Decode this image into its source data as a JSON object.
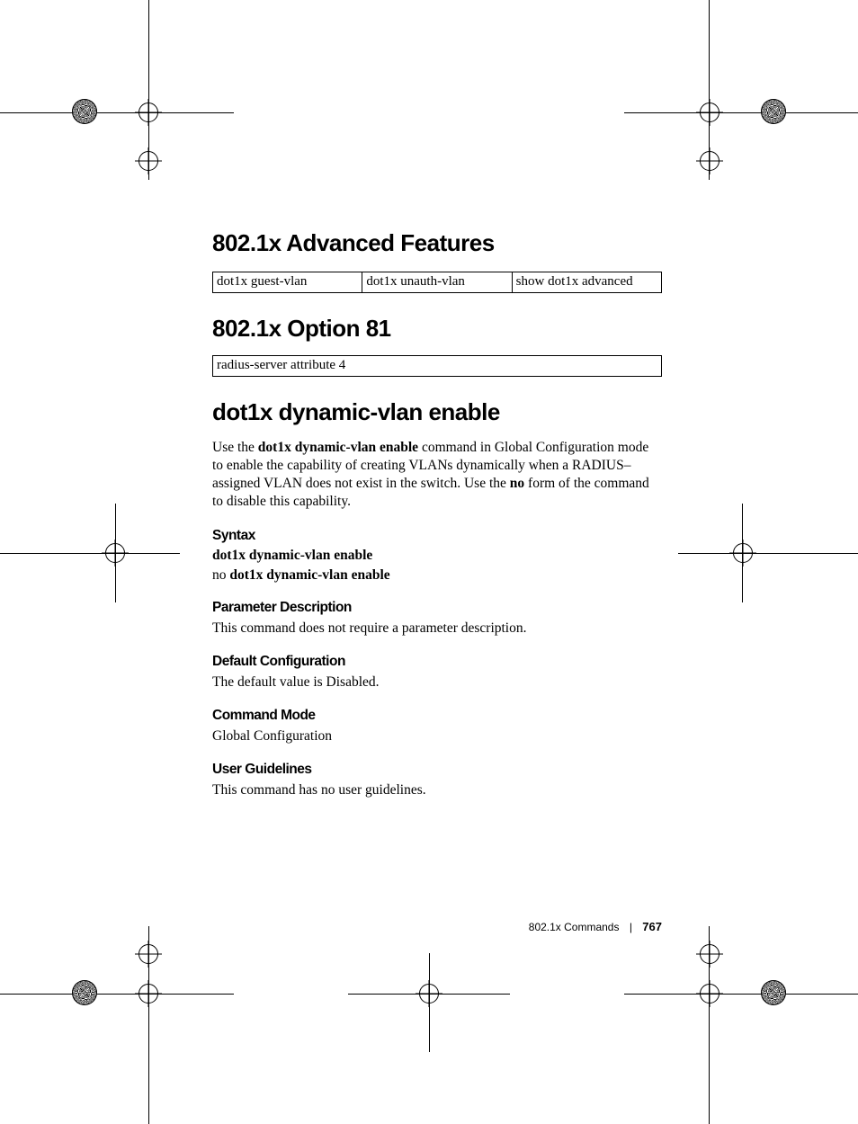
{
  "headings": {
    "advanced": "802.1x Advanced Features",
    "option81": "802.1x Option 81",
    "dynvlan": "dot1x dynamic-vlan enable"
  },
  "tables": {
    "advanced": [
      "dot1x guest-vlan",
      "dot1x unauth-vlan",
      "show dot1x advanced"
    ],
    "option81": [
      "radius-server attribute 4"
    ]
  },
  "dynvlan_para": {
    "pre": "Use the ",
    "cmd": "dot1x dynamic-vlan enable",
    "mid": " command in Global Configuration mode to enable the capability of creating VLANs dynamically when a RADIUS–assigned VLAN does not exist in the switch. Use the ",
    "no": "no",
    "post": " form of the command to disable this capability."
  },
  "sections": {
    "syntax": {
      "title": "Syntax",
      "line1": "dot1x dynamic-vlan enable",
      "line2_no": "no ",
      "line2_cmd": "dot1x dynamic-vlan enable"
    },
    "paramdesc": {
      "title": "Parameter Description",
      "body": "This command does not require a parameter description."
    },
    "defcfg": {
      "title": "Default Configuration",
      "body": "The default value is Disabled."
    },
    "cmdmode": {
      "title": "Command Mode",
      "body": "Global Configuration"
    },
    "userguide": {
      "title": "User Guidelines",
      "body": "This command has no user guidelines."
    }
  },
  "footer": {
    "section": "802.1x Commands",
    "page": "767"
  }
}
